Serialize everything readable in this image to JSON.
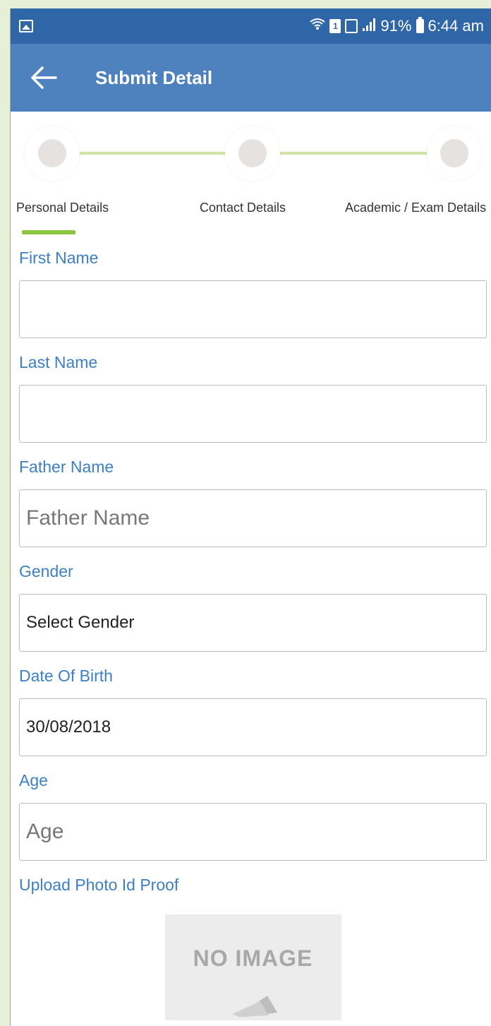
{
  "status_bar": {
    "battery": "91%",
    "time": "6:44 am",
    "icons": [
      "gallery-icon",
      "wifi-icon",
      "sim-icon",
      "data-icon",
      "signal-icon",
      "battery-icon"
    ]
  },
  "app_bar": {
    "title": "Submit Detail",
    "back_icon": "back-arrow-icon"
  },
  "colors": {
    "status_bar": "#2f66a8",
    "app_bar": "#4d82bf",
    "label": "#3d7fc4",
    "step_line": "#cfe2a8",
    "step_indicator": "#8cc63f",
    "background": "#e6f0d8"
  },
  "stepper": {
    "steps": [
      {
        "label": "Personal Details",
        "active": true
      },
      {
        "label": "Contact Details",
        "active": false
      },
      {
        "label": "Academic / Exam Details",
        "active": false
      }
    ]
  },
  "form": {
    "first_name": {
      "label": "First Name",
      "value": "",
      "placeholder": ""
    },
    "last_name": {
      "label": "Last Name",
      "value": "",
      "placeholder": ""
    },
    "father_name": {
      "label": "Father Name",
      "value": "",
      "placeholder": "Father Name"
    },
    "gender": {
      "label": "Gender",
      "value": "Select Gender"
    },
    "dob": {
      "label": "Date Of Birth",
      "value": "30/08/2018"
    },
    "age": {
      "label": "Age",
      "value": "",
      "placeholder": "Age"
    },
    "photo": {
      "label": "Upload Photo Id Proof",
      "no_image_text": "NO IMAGE"
    }
  }
}
